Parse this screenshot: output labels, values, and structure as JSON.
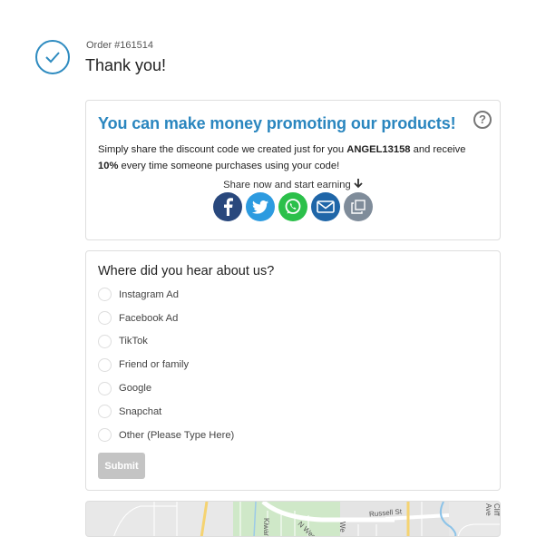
{
  "header": {
    "order_number": "Order #161514",
    "title": "Thank you!"
  },
  "promo": {
    "title": "You can make money promoting our products!",
    "text_before": "Simply share the discount code we created just for you ",
    "code": "ANGEL13158",
    "text_middle": " and receive ",
    "percent": "10%",
    "text_after": " every time someone purchases using your code!",
    "share_prompt": "Share now and start earning",
    "share_buttons": [
      {
        "name": "facebook",
        "icon": "facebook-icon",
        "color": "#29487d"
      },
      {
        "name": "twitter",
        "icon": "twitter-icon",
        "color": "#2d9be0"
      },
      {
        "name": "whatsapp",
        "icon": "whatsapp-icon",
        "color": "#2bc04a"
      },
      {
        "name": "email",
        "icon": "email-icon",
        "color": "#1f66a8"
      },
      {
        "name": "copy",
        "icon": "copy-icon",
        "color": "#7f8c9a"
      }
    ],
    "help_glyph": "?"
  },
  "survey": {
    "question": "Where did you hear about us?",
    "options": [
      "Instagram Ad",
      "Facebook Ad",
      "TikTok",
      "Friend or family",
      "Google",
      "Snapchat",
      "Other (Please Type Here)"
    ],
    "submit_label": "Submit"
  },
  "map": {
    "labels": [
      "Russell St",
      "Kiwan",
      "N West",
      "We",
      "Cliff Ave"
    ]
  },
  "colors": {
    "accent": "#2a86bf",
    "submit_disabled": "#c4c4c4"
  }
}
